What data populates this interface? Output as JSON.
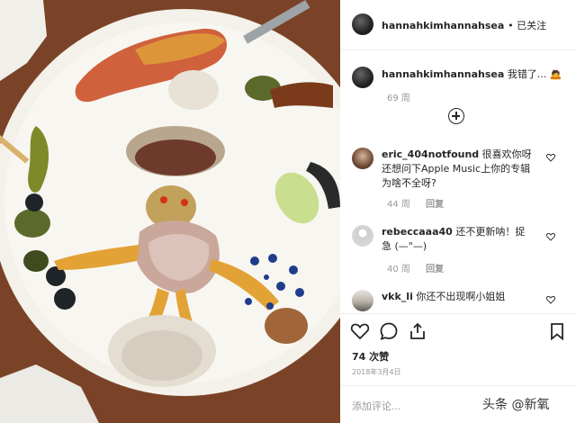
{
  "header": {
    "username": "hannahkimhannahsea",
    "follow_status": "• 已关注"
  },
  "caption": {
    "username": "hannahkimhannahsea",
    "text": "我错了...",
    "emoji": "🙇",
    "time": "69 周"
  },
  "comments": [
    {
      "username": "eric_404notfound",
      "text": "很喜欢你呀 还想问下Apple Music上你的专辑为啥不全呀?",
      "time": "44 周",
      "reply_label": "回复"
    },
    {
      "username": "rebeccaaa40",
      "text": "还不更新呐！捉急 (—\"—)",
      "time": "40 周",
      "reply_label": "回复"
    },
    {
      "username": "vkk_li",
      "text": "你还不出现啊小姐姐",
      "time": "",
      "reply_label": ""
    }
  ],
  "likes": "74 次赞",
  "date": "2018年3月4日",
  "add_comment_placeholder": "添加评论...",
  "watermark": "头条 @新氧",
  "icons": [
    "heart-icon",
    "comment-icon",
    "share-icon",
    "bookmark-icon",
    "plus-circle-icon",
    "like-comment-icon"
  ]
}
